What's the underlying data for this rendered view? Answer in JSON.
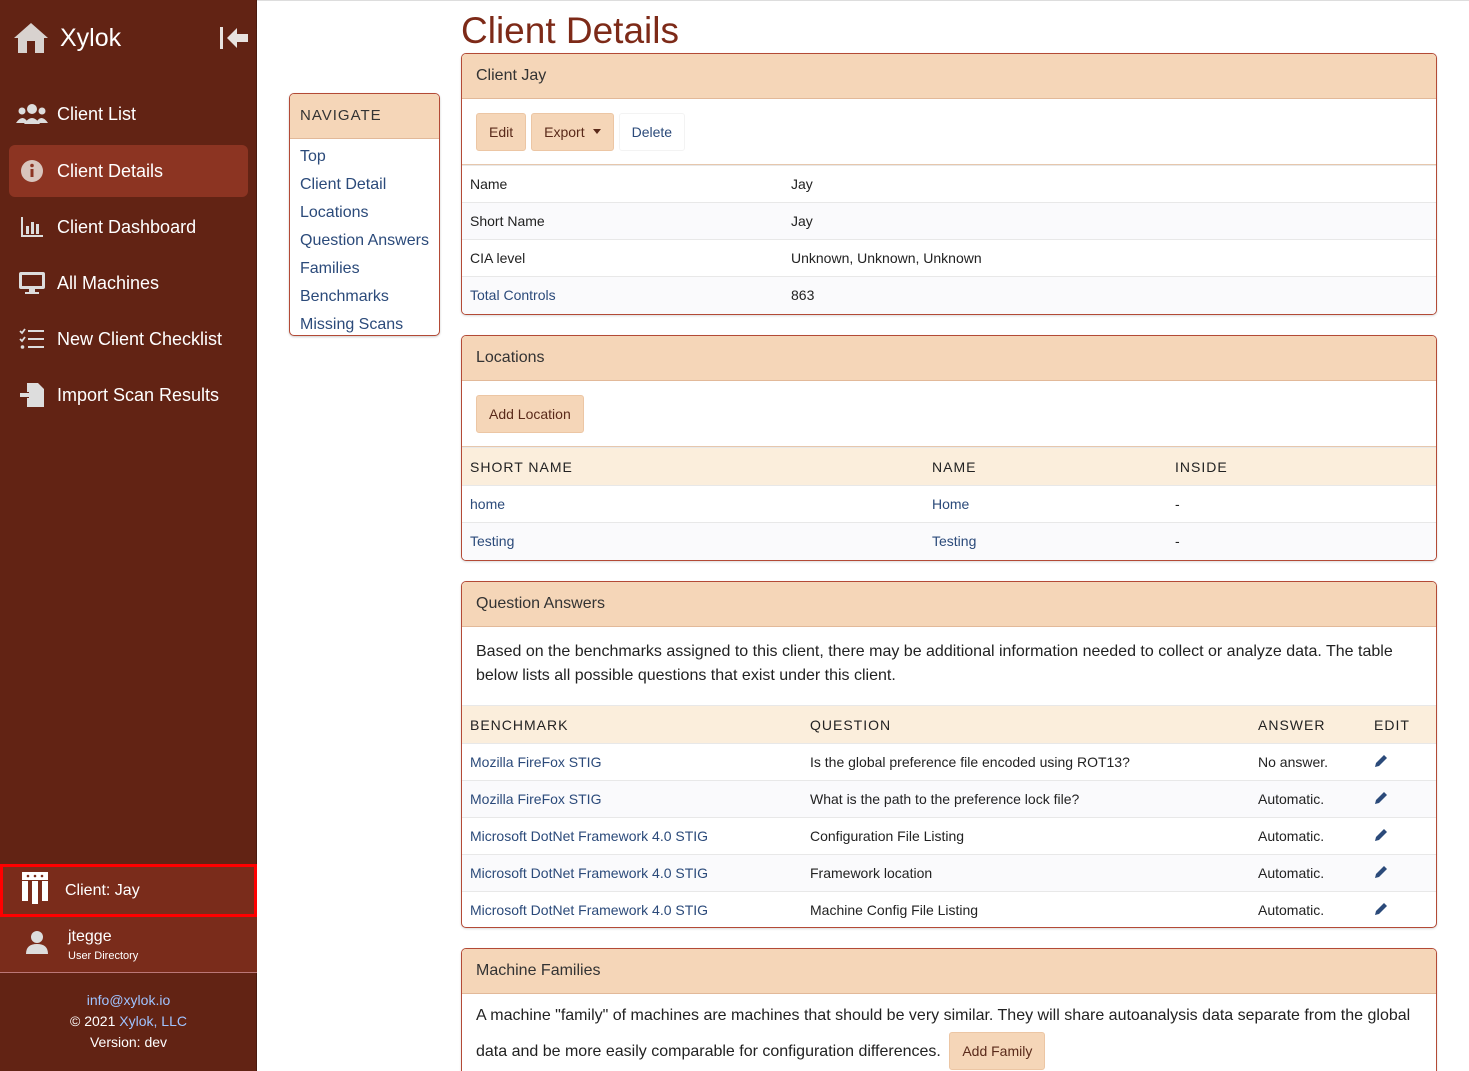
{
  "app": {
    "name": "Xylok"
  },
  "sidebar": {
    "items": [
      {
        "label": "Client List",
        "icon": "users-icon",
        "active": false
      },
      {
        "label": "Client Details",
        "icon": "info-icon",
        "active": true
      },
      {
        "label": "Client Dashboard",
        "icon": "bar-chart-icon",
        "active": false
      },
      {
        "label": "All Machines",
        "icon": "monitor-icon",
        "active": false
      },
      {
        "label": "New Client Checklist",
        "icon": "checklist-icon",
        "active": false
      },
      {
        "label": "Import Scan Results",
        "icon": "import-file-icon",
        "active": false
      }
    ],
    "client": "Client: Jay",
    "user": {
      "name": "jtegge",
      "directory": "User Directory"
    },
    "footer": {
      "email": "info@xylok.io",
      "copyright": "© 2021",
      "company": "Xylok, LLC",
      "version": "Version: dev"
    }
  },
  "navigate": {
    "title": "NAVIGATE",
    "links": [
      "Top",
      "Client Detail",
      "Locations",
      "Question Answers",
      "Families",
      "Benchmarks",
      "Missing Scans"
    ]
  },
  "page": {
    "title": "Client Details"
  },
  "client_card": {
    "title": "Client Jay",
    "buttons": {
      "edit": "Edit",
      "export": "Export",
      "delete": "Delete"
    },
    "rows": [
      {
        "label": "Name",
        "value": "Jay"
      },
      {
        "label": "Short Name",
        "value": "Jay"
      },
      {
        "label": "CIA level",
        "value": "Unknown, Unknown, Unknown"
      },
      {
        "label": "Total Controls",
        "value": "863"
      }
    ]
  },
  "locations": {
    "title": "Locations",
    "add_button": "Add Location",
    "headers": [
      "SHORT NAME",
      "NAME",
      "INSIDE"
    ],
    "rows": [
      {
        "short_name": "home",
        "name": "Home",
        "inside": "-"
      },
      {
        "short_name": "Testing",
        "name": "Testing",
        "inside": "-"
      }
    ]
  },
  "questions": {
    "title": "Question Answers",
    "description": "Based on the benchmarks assigned to this client, there may be additional information needed to collect or analyze data. The table below lists all possible questions that exist under this client.",
    "headers": [
      "BENCHMARK",
      "QUESTION",
      "ANSWER",
      "EDIT"
    ],
    "rows": [
      {
        "benchmark": "Mozilla FireFox STIG",
        "question": "Is the global preference file encoded using ROT13?",
        "answer": "No answer."
      },
      {
        "benchmark": "Mozilla FireFox STIG",
        "question": "What is the path to the preference lock file?",
        "answer": "Automatic."
      },
      {
        "benchmark": "Microsoft DotNet Framework 4.0 STIG",
        "question": "Configuration File Listing",
        "answer": "Automatic."
      },
      {
        "benchmark": "Microsoft DotNet Framework 4.0 STIG",
        "question": "Framework location",
        "answer": "Automatic."
      },
      {
        "benchmark": "Microsoft DotNet Framework 4.0 STIG",
        "question": "Machine Config File Listing",
        "answer": "Automatic."
      }
    ]
  },
  "families": {
    "title": "Machine Families",
    "description": "A machine \"family\" of machines are machines that should be very similar. They will share autoanalysis data separate from the global data and be more easily comparable for configuration differences.",
    "add_button": "Add Family"
  },
  "colors": {
    "sidebar_bg": "#622314",
    "accent": "#7d2a18",
    "card_header": "#f5d6b8",
    "link": "#2b4a7a",
    "highlight_border": "#ff0000"
  }
}
